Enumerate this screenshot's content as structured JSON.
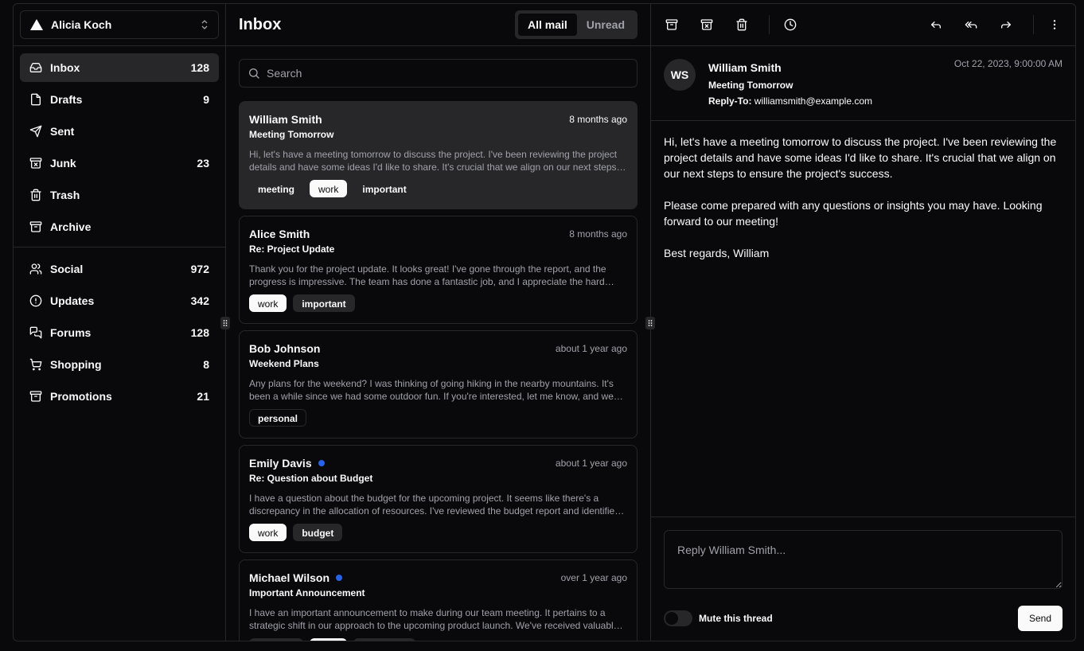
{
  "account": {
    "name": "Alicia Koch"
  },
  "nav_primary": [
    {
      "label": "Inbox",
      "count": "128",
      "icon": "inbox-icon"
    },
    {
      "label": "Drafts",
      "count": "9",
      "icon": "file-icon"
    },
    {
      "label": "Sent",
      "count": "",
      "icon": "send-icon"
    },
    {
      "label": "Junk",
      "count": "23",
      "icon": "archive-x-icon"
    },
    {
      "label": "Trash",
      "count": "",
      "icon": "trash-icon"
    },
    {
      "label": "Archive",
      "count": "",
      "icon": "archive-icon"
    }
  ],
  "nav_secondary": [
    {
      "label": "Social",
      "count": "972",
      "icon": "users-icon"
    },
    {
      "label": "Updates",
      "count": "342",
      "icon": "alert-circle-icon"
    },
    {
      "label": "Forums",
      "count": "128",
      "icon": "messages-icon"
    },
    {
      "label": "Shopping",
      "count": "8",
      "icon": "cart-icon"
    },
    {
      "label": "Promotions",
      "count": "21",
      "icon": "archive-icon"
    }
  ],
  "list": {
    "title": "Inbox",
    "tabs": [
      "All mail",
      "Unread"
    ],
    "search_placeholder": "Search"
  },
  "mails": [
    {
      "from": "William Smith",
      "when": "8 months ago",
      "subject": "Meeting Tomorrow",
      "unread": false,
      "preview": "Hi, let's have a meeting tomorrow to discuss the project. I've been reviewing the project details and have some ideas I'd like to share. It's crucial that we align on our next steps to ensure the project's success.",
      "tags": [
        {
          "label": "meeting",
          "style": "outline"
        },
        {
          "label": "work",
          "style": "white"
        },
        {
          "label": "important",
          "style": "outline"
        }
      ]
    },
    {
      "from": "Alice Smith",
      "when": "8 months ago",
      "subject": "Re: Project Update",
      "unread": false,
      "preview": "Thank you for the project update. It looks great! I've gone through the report, and the progress is impressive. The team has done a fantastic job, and I appreciate the hard work everyone has put in.",
      "tags": [
        {
          "label": "work",
          "style": "white"
        },
        {
          "label": "important",
          "style": "gray"
        }
      ]
    },
    {
      "from": "Bob Johnson",
      "when": "about 1 year ago",
      "subject": "Weekend Plans",
      "unread": false,
      "preview": "Any plans for the weekend? I was thinking of going hiking in the nearby mountains. It's been a while since we had some outdoor fun. If you're interested, let me know, and we can plan the details.",
      "tags": [
        {
          "label": "personal",
          "style": "outline"
        }
      ]
    },
    {
      "from": "Emily Davis",
      "when": "about 1 year ago",
      "subject": "Re: Question about Budget",
      "unread": true,
      "preview": "I have a question about the budget for the upcoming project. It seems like there's a discrepancy in the allocation of resources. I've reviewed the budget report and identified a few areas where we might be able to optimize.",
      "tags": [
        {
          "label": "work",
          "style": "white"
        },
        {
          "label": "budget",
          "style": "gray"
        }
      ]
    },
    {
      "from": "Michael Wilson",
      "when": "over 1 year ago",
      "subject": "Important Announcement",
      "unread": true,
      "preview": "I have an important announcement to make during our team meeting. It pertains to a strategic shift in our approach to the upcoming product launch. We've received valuable feedback from our beta testers.",
      "tags": [
        {
          "label": "meeting",
          "style": "gray"
        },
        {
          "label": "work",
          "style": "white"
        },
        {
          "label": "important",
          "style": "gray"
        }
      ]
    }
  ],
  "reader": {
    "avatar_initials": "WS",
    "from": "William Smith",
    "subject": "Meeting Tomorrow",
    "reply_to_label": "Reply-To:",
    "reply_to": "williamsmith@example.com",
    "date": "Oct 22, 2023, 9:00:00 AM",
    "body": [
      "Hi, let's have a meeting tomorrow to discuss the project. I've been reviewing the project details and have some ideas I'd like to share. It's crucial that we align on our next steps to ensure the project's success.",
      "Please come prepared with any questions or insights you may have. Looking forward to our meeting!",
      "Best regards, William"
    ],
    "reply_placeholder": "Reply William Smith...",
    "mute_label": "Mute this thread",
    "send_label": "Send"
  },
  "colors": {
    "background": "#09090b",
    "border": "#27272a",
    "muted_text": "#a1a1aa",
    "unread_dot": "#2563eb"
  }
}
